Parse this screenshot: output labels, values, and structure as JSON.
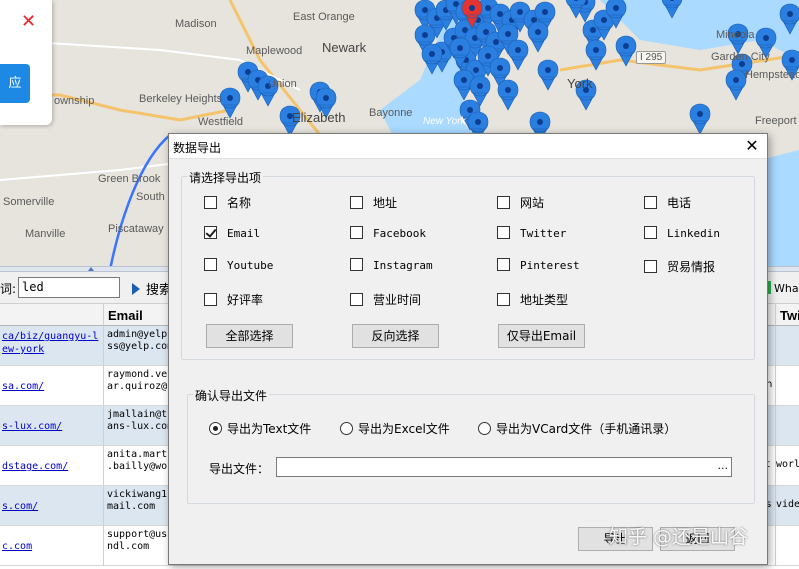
{
  "map": {
    "places": [
      "Madison",
      "East Orange",
      "Newark",
      "Maplewood",
      "Union",
      "Berkeley Heights",
      "Westfield",
      "Elizabeth",
      "Bayonne",
      "Green Brook",
      "South Pl",
      "Somerville",
      "Manville",
      "Piscataway",
      "Mineola",
      "Garden City",
      "Hempstead",
      "Freeport",
      "York",
      "ownship",
      "New York"
    ],
    "shield": "I 295"
  },
  "popup": {
    "close_glyph": "✕",
    "button_label": "应"
  },
  "toolbar": {
    "keyword_label": "词:",
    "keyword_value": "led",
    "search_label": "搜索",
    "whatsapp_label": "What"
  },
  "grid": {
    "headers": {
      "email": "Email",
      "twitter": "Twi"
    },
    "rows": [
      {
        "url": "ca/biz/guangyu-l\new-york",
        "email": "admin@yelp.\nss@yelp.com",
        "extra": "",
        "twitter": ""
      },
      {
        "url": "sa.com/",
        "email": "raymond.ve\nar.quiroz@",
        "extra": "n",
        "twitter": ""
      },
      {
        "url": "s-lux.com/",
        "email": "jmallain@t\nans-lux.com",
        "extra": "",
        "twitter": ""
      },
      {
        "url": "dstage.com/",
        "email": "anita.marti\n.bailly@wo",
        "extra": "t",
        "twitter": "worl"
      },
      {
        "url": "s.com/",
        "email": "vickiwang1\nmail.com",
        "extra": "s",
        "twitter": "vide"
      },
      {
        "url": "c.com",
        "email": "support@us\nndl.com",
        "extra": "",
        "twitter": ""
      }
    ]
  },
  "dialog": {
    "title": "数据导出",
    "close_glyph": "✕",
    "select_group_title": "请选择导出项",
    "fields": [
      {
        "label": "名称",
        "checked": false,
        "mono": false
      },
      {
        "label": "地址",
        "checked": false,
        "mono": false
      },
      {
        "label": "网站",
        "checked": false,
        "mono": false
      },
      {
        "label": "电话",
        "checked": false,
        "mono": false
      },
      {
        "label": "Email",
        "checked": true,
        "mono": true
      },
      {
        "label": "Facebook",
        "checked": false,
        "mono": true
      },
      {
        "label": "Twitter",
        "checked": false,
        "mono": true
      },
      {
        "label": "Linkedin",
        "checked": false,
        "mono": true
      },
      {
        "label": "Youtube",
        "checked": false,
        "mono": true
      },
      {
        "label": "Instagram",
        "checked": false,
        "mono": true
      },
      {
        "label": "Pinterest",
        "checked": false,
        "mono": true
      },
      {
        "label": "贸易情报",
        "checked": false,
        "mono": false
      },
      {
        "label": "好评率",
        "checked": false,
        "mono": false
      },
      {
        "label": "营业时间",
        "checked": false,
        "mono": false
      },
      {
        "label": "地址类型",
        "checked": false,
        "mono": false
      }
    ],
    "select_all": "全部选择",
    "invert_select": "反向选择",
    "email_only": "仅导出Email",
    "file_group_title": "确认导出文件",
    "formats": [
      {
        "label": "导出为Text文件",
        "selected": true
      },
      {
        "label": "导出为Excel文件",
        "selected": false
      },
      {
        "label": "导出为VCard文件（手机通讯录）",
        "selected": false
      }
    ],
    "file_label": "导出文件：",
    "file_value": "",
    "browse_label": "...",
    "export_label": "导出",
    "cancel_label": "返回"
  },
  "watermark": "知乎 @还是山谷",
  "colors": {
    "pin_blue": "#2b7fe0",
    "pin_red": "#e3342f",
    "selected_row": "#dce6f1",
    "accent": "#1e88e5"
  }
}
